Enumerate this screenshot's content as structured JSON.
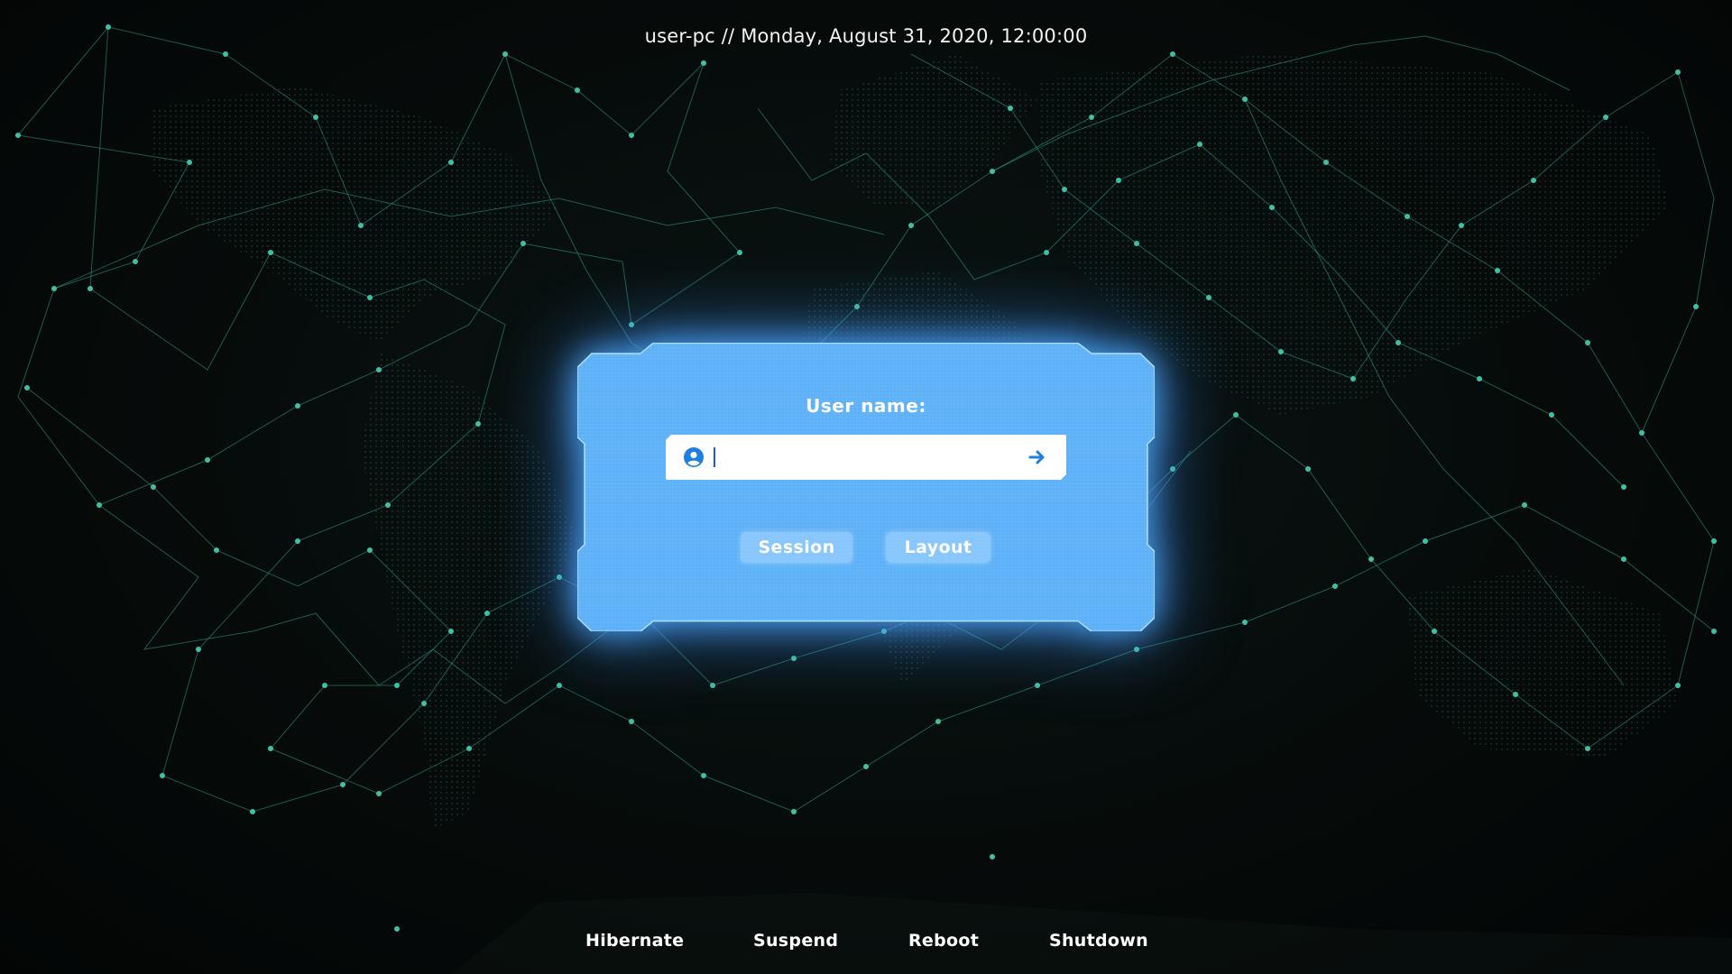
{
  "header": {
    "datetime_text": "user-pc // Monday, August 31, 2020, 12:00:00"
  },
  "login": {
    "label": "User name:",
    "username_value": "",
    "user_icon": "user-circle-icon",
    "submit_icon": "arrow-right-icon",
    "session_label": "Session",
    "layout_label": "Layout"
  },
  "power": {
    "hibernate_label": "Hibernate",
    "suspend_label": "Suspend",
    "reboot_label": "Reboot",
    "shutdown_label": "Shutdown"
  },
  "colors": {
    "panel_fill": "#5fb2f8",
    "panel_glow": "#49a6ff",
    "network_lines": "#2f9c86",
    "icon_accent": "#1f7fe0",
    "background": "#050908"
  }
}
